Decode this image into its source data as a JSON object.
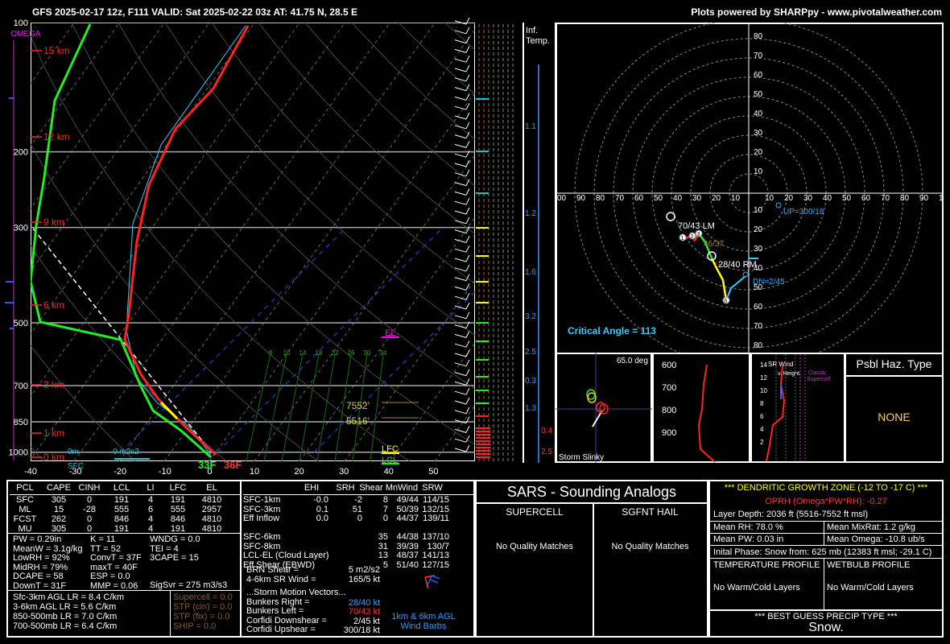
{
  "header": {
    "left": "GFS 2025-02-17 12z, F111  VALID: Sat 2025-02-22 03z  AT: 41.75 N, 28.5 E",
    "right": "Plots powered by SHARPpy - www.pivotalweather.com"
  },
  "skewt": {
    "omega_label": "OMEGA",
    "pressure_levels": [
      "100",
      "200",
      "300",
      "500",
      "700",
      "850",
      "1000"
    ],
    "height_labels": [
      "15 km",
      "12 km",
      "9 km",
      "6 km",
      "3 km",
      "1 km",
      "0 km"
    ],
    "temp_ticks": [
      "-40",
      "-30",
      "-20",
      "-10",
      "0",
      "10",
      "20",
      "30",
      "40",
      "50"
    ],
    "sfc_temp": "36F",
    "sfc_dew": "33F",
    "sfc_label": "SFC",
    "zero_label": "0m",
    "srh_label": "0 m2s2",
    "el_label": "EL",
    "lfc_label": "LFC",
    "lcl_label": "LCL",
    "dgz_top": "7552'",
    "dgz_bot": "5516'",
    "mixing_ratios": [
      "8",
      "10",
      "14",
      "18",
      "22",
      "26",
      "30",
      "34"
    ]
  },
  "chart_data": {
    "type": "line",
    "title": "",
    "xlabel": "",
    "ylabel": "",
    "xlim": [
      -40,
      50
    ],
    "ylim": [
      1050,
      100
    ],
    "yscale": "log",
    "series": [
      {
        "name": "",
        "color": "#ff2222",
        "x": [
          1.4,
          2.6,
          -2.5,
          -8.5,
          -14,
          -22,
          -28,
          -35,
          -46,
          -48,
          -47
        ],
        "y": [
          1000,
          975,
          925,
          850,
          750,
          600,
          500,
          400,
          300,
          200,
          100
        ]
      },
      {
        "name": "",
        "color": "#22ee22",
        "x": [
          -0.6,
          -1.5,
          -4.5,
          -11,
          -20,
          -25,
          -43,
          -56,
          -60,
          -62,
          -74
        ],
        "y": [
          1000,
          975,
          925,
          850,
          700,
          600,
          500,
          400,
          300,
          200,
          100
        ]
      },
      {
        "name": "",
        "color": "#ffffff",
        "x": [
          1.4,
          -2,
          -8,
          -15,
          -23,
          -33,
          -46
        ],
        "y": [
          1000,
          925,
          850,
          750,
          650,
          550,
          450
        ]
      }
    ]
  },
  "inflow": {
    "title": "Inf.",
    "title2": "Temp.",
    "values": [
      "1.1",
      "1.2",
      "1.6",
      "3.2",
      "2.5",
      "0.3",
      "1.3"
    ],
    "low_values": [
      "0.4",
      "2.5"
    ]
  },
  "hodograph": {
    "speed_labels": [
      "80",
      "70",
      "60",
      "50",
      "40",
      "30",
      "20",
      "10"
    ],
    "dir_labels_left": [
      "00",
      "90",
      "80",
      "70",
      "60",
      "50",
      "40",
      "30",
      "20",
      "10"
    ],
    "dir_labels_right": [
      "10",
      "20",
      "30",
      "40",
      "50",
      "60",
      "70",
      "80",
      "90",
      "1"
    ],
    "lower_labels": [
      "10",
      "20",
      "30",
      "40",
      "50",
      "60",
      "70",
      "80"
    ],
    "lm": "70/43 LM",
    "rm": "28/40 RM",
    "mean": "46/37",
    "up": "UP=300/18",
    "dn": "DN=2/45",
    "critical_angle": "Critical Angle = 113",
    "points": [
      "1",
      "2",
      "3",
      "6"
    ]
  },
  "slinky": {
    "deg": "65.0 deg",
    "label": "Storm Slinky"
  },
  "theta": {
    "levels": [
      "600",
      "700",
      "800",
      "900"
    ]
  },
  "srwind": {
    "title": "SR Wind",
    "sub": "v. Height",
    "classic": "Classic",
    "supercell": "Supercell",
    "heights": [
      "14",
      "12",
      "10",
      "8",
      "6",
      "4",
      "2"
    ]
  },
  "hazard": {
    "title": "Psbl Haz. Type",
    "value": "NONE"
  },
  "parcels": {
    "headers": [
      "PCL",
      "CAPE",
      "CINH",
      "LCL",
      "LI",
      "LFC",
      "EL"
    ],
    "rows": [
      [
        "SFC",
        "305",
        "0",
        "191",
        "4",
        "191",
        "4810"
      ],
      [
        "ML",
        "15",
        "-28",
        "555",
        "6",
        "555",
        "2957"
      ],
      [
        "FCST",
        "262",
        "0",
        "846",
        "4",
        "846",
        "4810"
      ],
      [
        "MU",
        "305",
        "0",
        "191",
        "4",
        "191",
        "4810"
      ]
    ]
  },
  "indices": {
    "col1": [
      "PW = 0.29in",
      "MeanW = 3.1g/kg",
      "LowRH = 92%",
      "MidRH = 79%",
      "DCAPE = 58",
      "DownT = 31F"
    ],
    "col2": [
      "K = 11",
      "TT = 52",
      "ConvT = 37F",
      "maxT = 40F",
      "ESP = 0.0",
      "MMP = 0.06"
    ],
    "col3": [
      "WNDG = 0.0",
      "TEI = 4",
      "3CAPE = 15",
      "",
      "",
      ""
    ],
    "sigsvr": "SigSvr = 275 m3/s3",
    "lapse": [
      "Sfc-3km AGL LR = 8.4 C/km",
      "3-6km AGL LR = 5.6 C/km",
      "850-500mb LR = 7.0 C/km",
      "700-500mb LR = 6.4 C/km"
    ],
    "composite": [
      "Supercell = 0.0",
      "STP (cin) = 0.0",
      "STP (fix) = 0.0",
      "SHIP = 0.0"
    ]
  },
  "kinematics": {
    "headers": [
      "EHI",
      "SRH",
      "Shear",
      "MnWind",
      "SRW"
    ],
    "rows": [
      [
        "SFC-1km",
        "-0.0",
        "-2",
        "8",
        "49/44",
        "114/15"
      ],
      [
        "SFC-3km",
        "0.1",
        "51",
        "7",
        "50/39",
        "132/15"
      ],
      [
        "Eff Inflow",
        "0.0",
        "0",
        "0",
        "44/37",
        "139/11"
      ],
      [
        "",
        "",
        "",
        "",
        "",
        ""
      ],
      [
        "SFC-6km",
        "",
        "",
        "35",
        "44/38",
        "137/10"
      ],
      [
        "SFC-8km",
        "",
        "",
        "31",
        "39/39",
        "130/7"
      ],
      [
        "LCL-EL (Cloud Layer)",
        "",
        "",
        "13",
        "48/37",
        "141/13"
      ],
      [
        "Eff Shear (EBWD)",
        "",
        "",
        "5",
        "51/40",
        "127/15"
      ]
    ],
    "brn": [
      "BRN Shear =",
      "5 m2/s2"
    ],
    "srw46": [
      "4-6km SR Wind =",
      "165/5 kt"
    ],
    "motion_title": "...Storm Motion Vectors...",
    "motion": [
      [
        "Bunkers Right =",
        "28/40 kt"
      ],
      [
        "Bunkers Left =",
        "70/43 kt"
      ],
      [
        "Corfidi Downshear =",
        "2/45 kt"
      ],
      [
        "Corfidi Upshear =",
        "300/18 kt"
      ]
    ],
    "barb_caption1": "1km & 6km AGL",
    "barb_caption2": "Wind Barbs"
  },
  "sars": {
    "title": "SARS - Sounding Analogs",
    "supercell": "SUPERCELL",
    "hail": "SGFNT HAIL",
    "nomatch": "No Quality Matches"
  },
  "dgz": {
    "title": "*** DENDRITIC GROWTH ZONE (-12 TO -17 C) ***",
    "oprh": "OPRH (Omega*PW*RH): -0.27",
    "depth": "Layer Depth: 2036 ft (5516-7552 ft msl)",
    "meanrh": "Mean RH: 78.0 %",
    "mixrat": "Mean MixRat: 1.2 g/kg",
    "meanpw": "Mean PW: 0.03 in",
    "omega": "Mean Omega: -10.8 ub/s",
    "phase": "Inital Phase: Snow from: 625 mb (12383 ft msl; -29.1 C)",
    "temp_profile": "TEMPERATURE PROFILE",
    "wetbulb_profile": "WETBULB PROFILE",
    "no_layers": "No Warm/Cold Layers",
    "best_title": "*** BEST GUESS PRECIP TYPE ***",
    "best": "Snow."
  },
  "colors": {
    "temp": "#ff2222",
    "dew": "#22ee22",
    "wetbulb": "#33ccff",
    "yellow": "#ffff00",
    "cyan": "#00ffff",
    "magenta": "#ff00ff",
    "red": "#ff3333"
  }
}
